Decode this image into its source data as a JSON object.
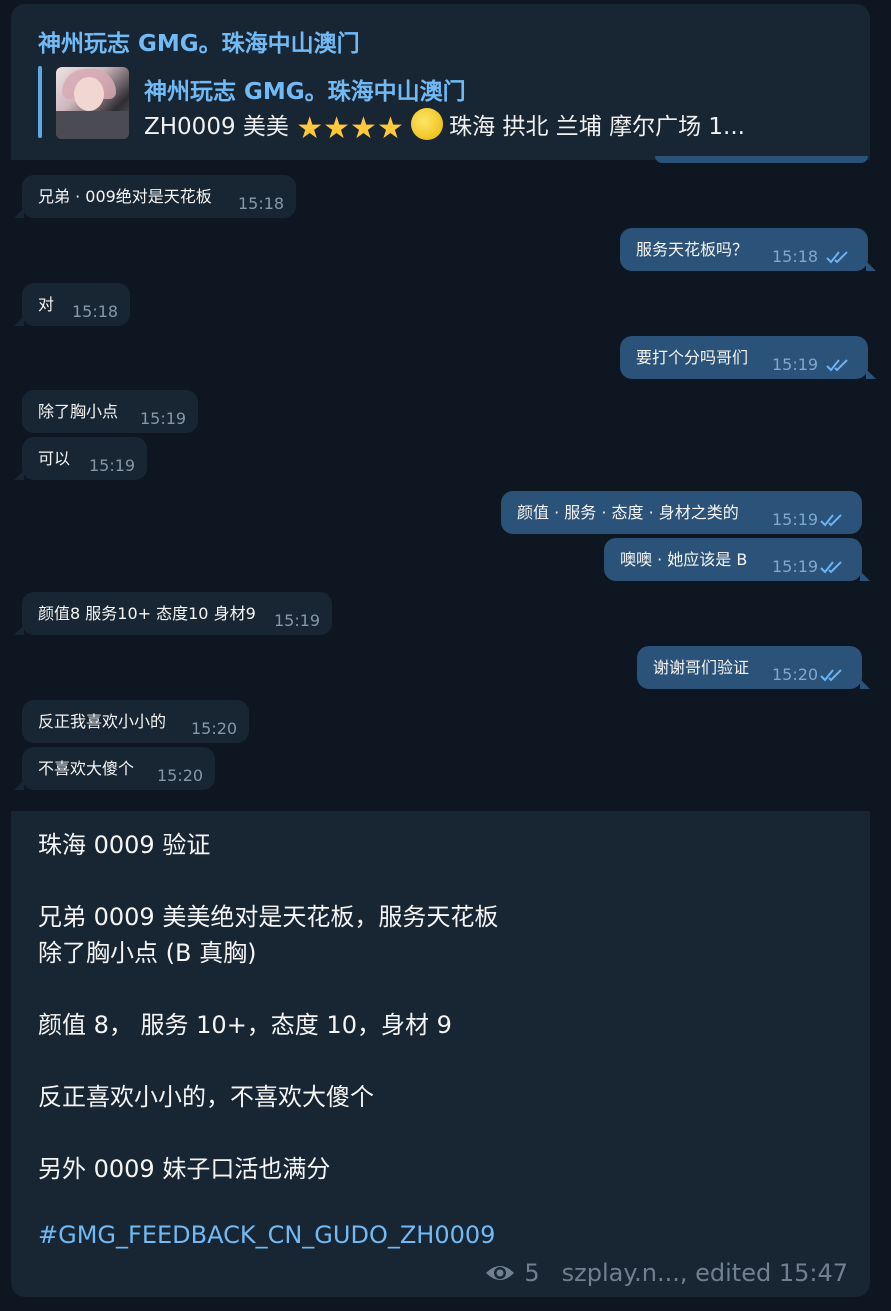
{
  "forward": {
    "title": "神州玩志 GMG。珠海中山澳门",
    "reply_name": "神州玩志 GMG。珠海中山澳门",
    "reply_prefix": "ZH0009 美美",
    "reply_suffix": "珠海 拱北 兰埔 摩尔广场 1..."
  },
  "messages": [
    {
      "dir": "in",
      "text": "兄弟 · 009绝对是天花板",
      "time": "15:18"
    },
    {
      "dir": "out",
      "text": "服务天花板吗？",
      "time": "15:18"
    },
    {
      "dir": "in",
      "text": "对",
      "time": "15:18"
    },
    {
      "dir": "out",
      "text": "要打个分吗哥们",
      "time": "15:19"
    },
    {
      "dir": "in",
      "text": "除了胸小点",
      "time": "15:19"
    },
    {
      "dir": "in",
      "text": "可以",
      "time": "15:19"
    },
    {
      "dir": "out",
      "text": "颜值 · 服务 · 态度 · 身材之类的",
      "time": "15:19"
    },
    {
      "dir": "out",
      "text": "噢噢 · 她应该是 B",
      "time": "15:19"
    },
    {
      "dir": "in",
      "text": "颜值8 服务10+ 态度10 身材9",
      "time": "15:19"
    },
    {
      "dir": "out",
      "text": "谢谢哥们验证",
      "time": "15:20"
    },
    {
      "dir": "in",
      "text": "反正我喜欢小小的",
      "time": "15:20"
    },
    {
      "dir": "in",
      "text": "不喜欢大傻个",
      "time": "15:20"
    }
  ],
  "post": {
    "lines": [
      "珠海 0009 验证",
      "兄弟 0009 美美绝对是天花板，服务天花板",
      "除了胸小点 (B 真胸)",
      "颜值 8， 服务 10+，态度 10，身材 9",
      "反正喜欢小小的，不喜欢大傻个",
      "另外 0009  妹子口活也满分"
    ],
    "hashtag": "#GMG_FEEDBACK_CN_GUDO_ZH0009",
    "views": "5",
    "footer": "szplay.n..., edited 15:47"
  },
  "colors": {
    "background": "#0e1621",
    "incoming_bubble": "#182533",
    "outgoing_bubble": "#2b5278",
    "accent": "#71baf5"
  }
}
